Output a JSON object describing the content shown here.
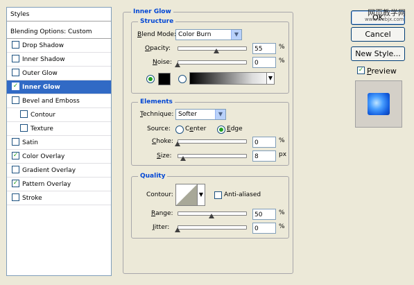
{
  "styles_panel": {
    "header": "Styles",
    "blending": "Blending Options: Custom",
    "items": [
      {
        "label": "Drop Shadow",
        "checked": false,
        "indent": false,
        "selected": false
      },
      {
        "label": "Inner Shadow",
        "checked": false,
        "indent": false,
        "selected": false
      },
      {
        "label": "Outer Glow",
        "checked": false,
        "indent": false,
        "selected": false
      },
      {
        "label": "Inner Glow",
        "checked": true,
        "indent": false,
        "selected": true
      },
      {
        "label": "Bevel and Emboss",
        "checked": false,
        "indent": false,
        "selected": false
      },
      {
        "label": "Contour",
        "checked": false,
        "indent": true,
        "selected": false
      },
      {
        "label": "Texture",
        "checked": false,
        "indent": true,
        "selected": false
      },
      {
        "label": "Satin",
        "checked": false,
        "indent": false,
        "selected": false
      },
      {
        "label": "Color Overlay",
        "checked": true,
        "indent": false,
        "selected": false
      },
      {
        "label": "Gradient Overlay",
        "checked": false,
        "indent": false,
        "selected": false
      },
      {
        "label": "Pattern Overlay",
        "checked": true,
        "indent": false,
        "selected": false
      },
      {
        "label": "Stroke",
        "checked": false,
        "indent": false,
        "selected": false
      }
    ]
  },
  "section_title": "Inner Glow",
  "structure": {
    "title": "Structure",
    "blend_mode_label": "Blend Mode:",
    "blend_mode_value": "Color Burn",
    "opacity_label": "Opacity:",
    "opacity_value": "55",
    "opacity_unit": "%",
    "noise_label": "Noise:",
    "noise_value": "0",
    "noise_unit": "%",
    "glow_color": "#000000"
  },
  "elements": {
    "title": "Elements",
    "technique_label": "Technique:",
    "technique_value": "Softer",
    "source_label": "Source:",
    "source_center": "Center",
    "source_edge": "Edge",
    "source_selected": "edge",
    "choke_label": "Choke:",
    "choke_value": "0",
    "choke_unit": "%",
    "size_label": "Size:",
    "size_value": "8",
    "size_unit": "px"
  },
  "quality": {
    "title": "Quality",
    "contour_label": "Contour:",
    "anti_aliased_label": "Anti-aliased",
    "anti_aliased_checked": false,
    "range_label": "Range:",
    "range_value": "50",
    "range_unit": "%",
    "jitter_label": "Jitter:",
    "jitter_value": "0",
    "jitter_unit": "%"
  },
  "buttons": {
    "ok": "OK",
    "cancel": "Cancel",
    "new_style": "New Style...",
    "preview_label": "Preview",
    "preview_checked": true
  },
  "watermark": {
    "line1": "网页教学网",
    "line2": "www.webjx.com"
  },
  "colors": {
    "selection": "#316ac5",
    "group_title": "#0046d5",
    "background": "#ece9d8"
  }
}
